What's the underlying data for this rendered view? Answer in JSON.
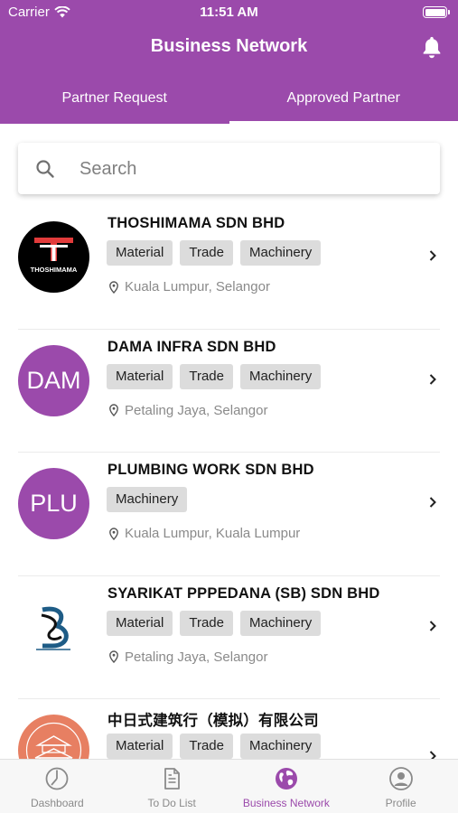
{
  "status_bar": {
    "carrier": "Carrier",
    "time": "11:51 AM"
  },
  "header": {
    "title": "Business Network"
  },
  "tabs": [
    {
      "label": "Partner Request",
      "active": false
    },
    {
      "label": "Approved Partner",
      "active": true
    }
  ],
  "search": {
    "placeholder": "Search",
    "value": ""
  },
  "partners": [
    {
      "name": "THOSHIMAMA SDN BHD",
      "avatar_type": "logo",
      "logo_text": "THOSHIMAMA",
      "tags": [
        "Material",
        "Trade",
        "Machinery"
      ],
      "location": "Kuala Lumpur, Selangor"
    },
    {
      "name": "DAMA INFRA SDN BHD",
      "avatar_type": "initials",
      "initials": "DAM",
      "tags": [
        "Material",
        "Trade",
        "Machinery"
      ],
      "location": "Petaling Jaya, Selangor"
    },
    {
      "name": "PLUMBING WORK SDN BHD",
      "avatar_type": "initials",
      "initials": "PLU",
      "tags": [
        "Machinery"
      ],
      "location": "Kuala Lumpur, Kuala Lumpur"
    },
    {
      "name": "SYARIKAT PPPEDANA (SB) SDN BHD",
      "avatar_type": "logo",
      "logo_text": "B",
      "tags": [
        "Material",
        "Trade",
        "Machinery"
      ],
      "location": "Petaling Jaya, Selangor"
    },
    {
      "name": "中日式建筑行（模拟）有限公司",
      "avatar_type": "logo",
      "tags": [
        "Material",
        "Trade",
        "Machinery"
      ],
      "location": ""
    }
  ],
  "bottom_nav": [
    {
      "label": "Dashboard",
      "icon": "dashboard-icon",
      "active": false
    },
    {
      "label": "To Do List",
      "icon": "document-icon",
      "active": false
    },
    {
      "label": "Business Network",
      "icon": "globe-icon",
      "active": true
    },
    {
      "label": "Profile",
      "icon": "profile-icon",
      "active": false
    }
  ],
  "colors": {
    "brand": "#9B4AAB",
    "tag_bg": "#DCDCDC",
    "muted_text": "#8A8A8A"
  }
}
